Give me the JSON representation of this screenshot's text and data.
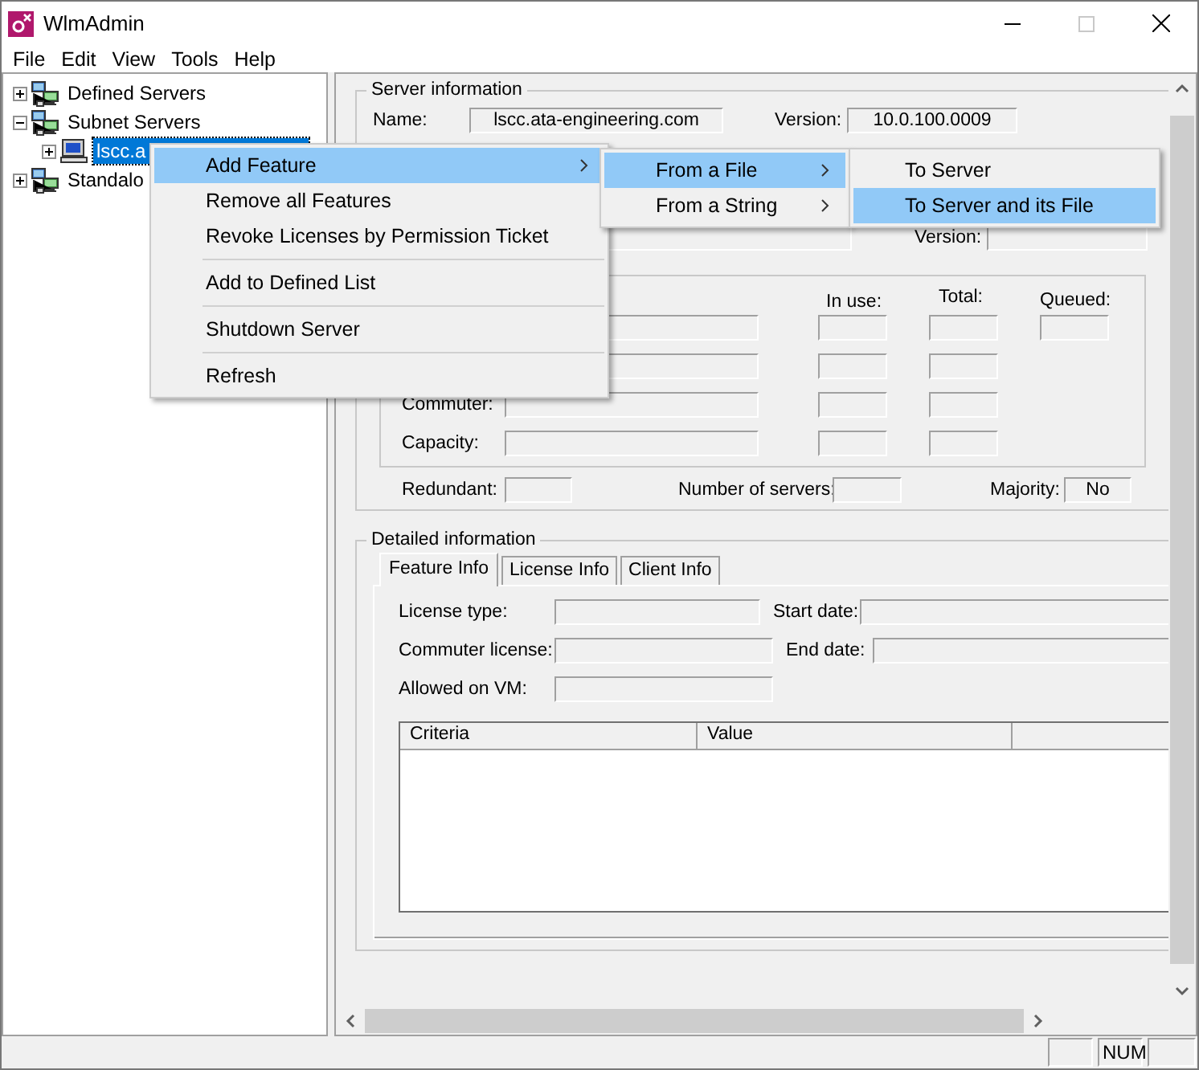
{
  "window": {
    "title": "WlmAdmin"
  },
  "menu_bar": [
    "File",
    "Edit",
    "View",
    "Tools",
    "Help"
  ],
  "tree": [
    {
      "label": "Defined Servers",
      "kind": "group",
      "expanded": false,
      "selected": false
    },
    {
      "label": "Subnet Servers",
      "kind": "group",
      "expanded": true,
      "selected": false,
      "children": [
        {
          "label": "lscc.a",
          "kind": "server",
          "expanded": false,
          "selected": true
        }
      ]
    },
    {
      "label": "Standalo",
      "kind": "group",
      "expanded": false,
      "selected": false
    }
  ],
  "server_information": {
    "title": "Server information",
    "name_label": "Name:",
    "name": "lscc.ata-engineering.com",
    "version_label": "Version:",
    "version": "10.0.100.0009",
    "version_label_2": "Version:",
    "license_headers": [
      "In use:",
      "Total:",
      "Queued:"
    ],
    "license_rows": [
      {
        "queued": true
      },
      {
        "queued": false
      },
      {
        "label": "Commuter:",
        "queued": false
      },
      {
        "label": "Capacity:",
        "queued": false
      }
    ],
    "redundant_label": "Redundant:",
    "servers_label": "Number of servers:",
    "majority_label": "Majority:",
    "majority": "No"
  },
  "detailed_information": {
    "title": "Detailed information",
    "tabs": [
      {
        "label": "Feature Info",
        "selected": true
      },
      {
        "label": "License Info",
        "selected": false
      },
      {
        "label": "Client Info",
        "selected": false
      }
    ],
    "license_type_label": "License type:",
    "start_date_label": "Start date:",
    "commuter_label": "Commuter license:",
    "end_date_label": "End date:",
    "vm_label": "Allowed on VM:",
    "table_columns": [
      "Criteria",
      "Value"
    ]
  },
  "context_menu": [
    {
      "kind": "item",
      "label": "Add Feature",
      "submenu": true,
      "selected": true
    },
    {
      "kind": "item",
      "label": "Remove all Features",
      "submenu": false,
      "selected": false
    },
    {
      "kind": "item",
      "label": "Revoke Licenses by Permission Ticket",
      "submenu": false,
      "selected": false
    },
    {
      "kind": "separator"
    },
    {
      "kind": "item",
      "label": "Add to Defined List",
      "submenu": false,
      "selected": false
    },
    {
      "kind": "separator"
    },
    {
      "kind": "item",
      "label": "Shutdown Server",
      "submenu": false,
      "selected": false
    },
    {
      "kind": "separator"
    },
    {
      "kind": "item",
      "label": "Refresh",
      "submenu": false,
      "selected": false
    }
  ],
  "submenu": [
    {
      "label": "From a File",
      "submenu": true,
      "selected": true
    },
    {
      "label": "From a String",
      "submenu": true,
      "selected": false
    }
  ],
  "submenu_2": [
    {
      "label": "To Server",
      "selected": false
    },
    {
      "label": "To Server and its File",
      "selected": true
    }
  ],
  "status_bar": {
    "num": "NUM"
  }
}
